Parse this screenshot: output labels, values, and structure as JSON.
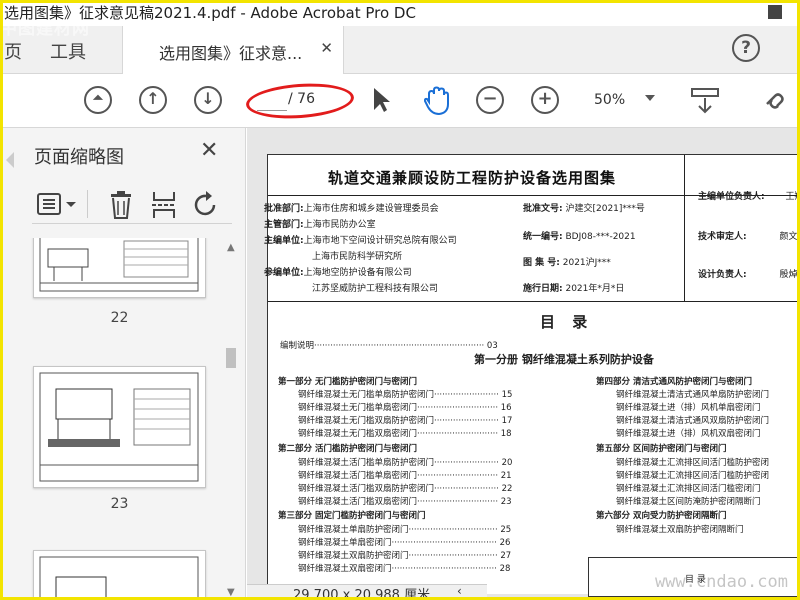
{
  "window": {
    "title": "选用图集》征求意见稿2021.4.pdf - Adobe Acrobat Pro DC"
  },
  "tabs": {
    "home": "页",
    "tools": "工具",
    "document": "选用图集》征求意..."
  },
  "toolbar": {
    "page_current": "",
    "page_total": "/ 76",
    "zoom": "50%"
  },
  "sidebar": {
    "title": "页面缩略图",
    "thumbnails": [
      {
        "label": "22"
      },
      {
        "label": "23"
      }
    ]
  },
  "status": {
    "page_size": "29.700 x 20.988 厘米"
  },
  "document": {
    "title": "轨道交通兼顾设防工程防护设备选用图集",
    "approvals": [
      {
        "label": "批准部门:",
        "value": "上海市住房和城乡建设管理委员会"
      },
      {
        "label": "主管部门:",
        "value": "上海市民防办公室"
      },
      {
        "label": "主编单位:",
        "value": "上海市地下空间设计研究总院有限公司"
      },
      {
        "label": "",
        "value": "上海市民防科学研究所"
      },
      {
        "label": "参编单位:",
        "value": "上海地空防护设备有限公司"
      },
      {
        "label": "",
        "value": "江苏坚威防护工程科技有限公司"
      }
    ],
    "meta": [
      {
        "label": "批准文号:",
        "value": "沪建交[2021]***号"
      },
      {
        "label": "统一编号:",
        "value": "BDJ08-***-2021"
      },
      {
        "label": "图 集 号:",
        "value": "2021沪J***"
      },
      {
        "label": "施行日期:",
        "value": "2021年*月*日"
      }
    ],
    "signers": [
      {
        "label": "主编单位负责人:",
        "value": "王翔"
      },
      {
        "label": "技术审定人:",
        "value": "颜文"
      },
      {
        "label": "设计负责人:",
        "value": "殷焯"
      }
    ],
    "toc_title": "目 录",
    "toc_intro": "编制说明······························································· 03",
    "part_one": "第一分册  钢纤维混凝土系列防护设备",
    "left_sections": [
      {
        "head": "第一部分  无门槛防护密闭门与密闭门",
        "items": [
          {
            "t": "钢纤维混凝土无门槛单扇防护密闭门························",
            "p": "15"
          },
          {
            "t": "钢纤维混凝土无门槛单扇密闭门······························",
            "p": "16"
          },
          {
            "t": "钢纤维混凝土无门槛双扇防护密闭门························",
            "p": "17"
          },
          {
            "t": "钢纤维混凝土无门槛双扇密闭门······························",
            "p": "18"
          }
        ]
      },
      {
        "head": "第二部分  活门槛防护密闭门与密闭门",
        "items": [
          {
            "t": "钢纤维混凝土活门槛单扇防护密闭门························",
            "p": "20"
          },
          {
            "t": "钢纤维混凝土活门槛单扇密闭门······························",
            "p": "21"
          },
          {
            "t": "钢纤维混凝土活门槛双扇防护密闭门························",
            "p": "22"
          },
          {
            "t": "钢纤维混凝土活门槛双扇密闭门······························",
            "p": "23"
          }
        ]
      },
      {
        "head": "第三部分  固定门槛防护密闭门与密闭门",
        "items": [
          {
            "t": "钢纤维混凝土单扇防护密闭门·································",
            "p": "25"
          },
          {
            "t": "钢纤维混凝土单扇密闭门·······································",
            "p": "26"
          },
          {
            "t": "钢纤维混凝土双扇防护密闭门·································",
            "p": "27"
          },
          {
            "t": "钢纤维混凝土双扇密闭门·······································",
            "p": "28"
          }
        ]
      }
    ],
    "right_sections": [
      {
        "head": "第四部分  清洁式通风防护密闭门与密闭门",
        "items": [
          "钢纤维混凝土清洁式通风单扇防护密闭门",
          "钢纤维混凝土进（排）风机单扇密闭门",
          "钢纤维混凝土清洁式通风双扇防护密闭门",
          "钢纤维混凝土进（排）风机双扇密闭门"
        ]
      },
      {
        "head": "第五部分  区间防护密闭门与密闭门",
        "items": [
          "钢纤维混凝土汇流排区间活门槛防护密闭",
          "钢纤维混凝土汇流排区间活门槛防护密闭",
          "钢纤维混凝土汇流排区间活门槛密闭门",
          "钢纤维混凝土区间防淹防护密闭隔断门"
        ]
      },
      {
        "head": "第六部分  双向受力防护密闭隔断门",
        "items": [
          "钢纤维混凝土双扇防护密闭隔断门"
        ]
      }
    ],
    "mini_box_text": "目  录"
  },
  "watermark": {
    "top_left": "中图建材网",
    "bottom_right": "www.cndao.com"
  },
  "colors": {
    "highlight_oval": "#e21c1c",
    "frame": "#f3e400"
  }
}
